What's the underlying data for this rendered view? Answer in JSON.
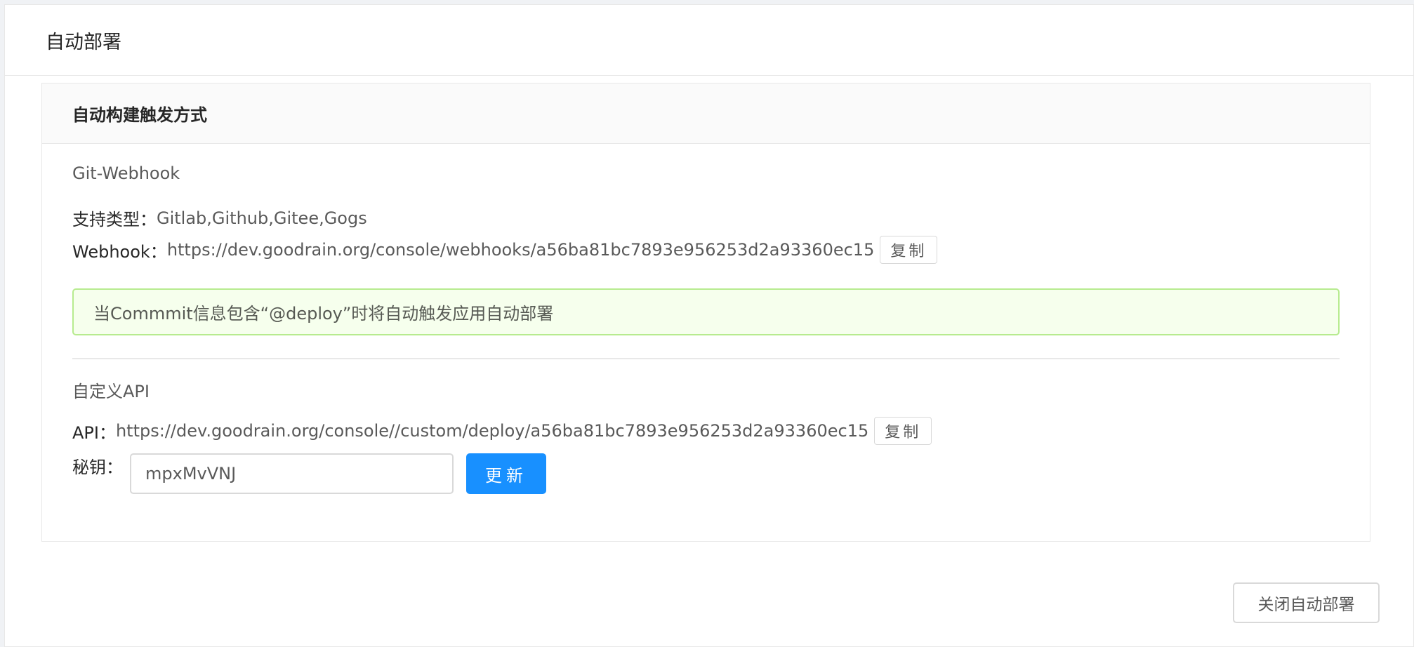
{
  "page": {
    "title": "自动部署"
  },
  "card": {
    "title": "自动构建触发方式"
  },
  "webhook_section": {
    "title": "Git-Webhook",
    "types_label": "支持类型：",
    "types_value": "Gitlab,Github,Gitee,Gogs",
    "url_label": "Webhook：",
    "url_value": "https://dev.goodrain.org/console/webhooks/a56ba81bc7893e956253d2a93360ec15",
    "copy_label": "复制",
    "alert_text": "当Commmit信息包含“@deploy”时将自动触发应用自动部署"
  },
  "api_section": {
    "title": "自定义API",
    "url_label": "API：",
    "url_value": "https://dev.goodrain.org/console//custom/deploy/a56ba81bc7893e956253d2a93360ec15",
    "copy_label": "复制",
    "secret_label": "秘钥：",
    "secret_value": "mpxMvVNJ",
    "update_label": "更新"
  },
  "footer": {
    "close_label": "关闭自动部署"
  },
  "colors": {
    "primary": "#1890ff",
    "alert_bg": "#f6ffed",
    "alert_border": "#b7eb8f"
  }
}
